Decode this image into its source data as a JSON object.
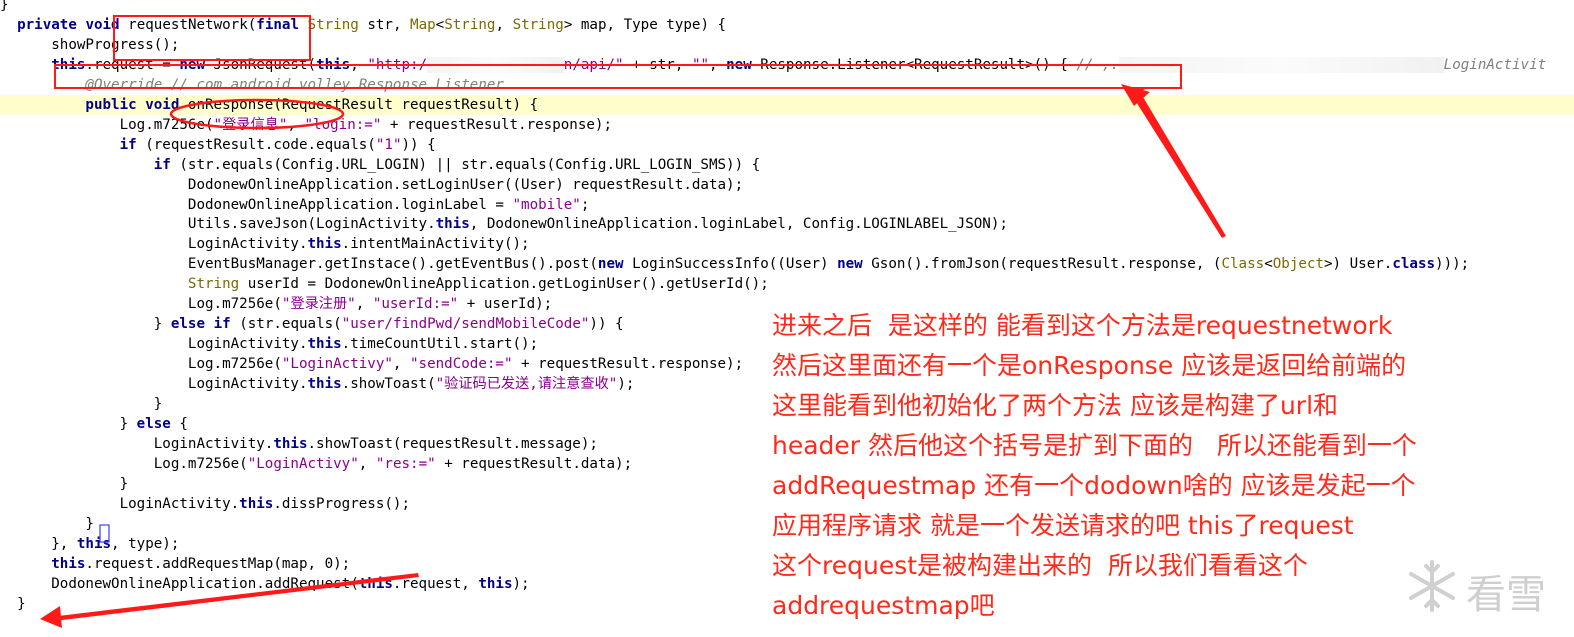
{
  "code_lines": [
    {
      "id": "l0",
      "segments": [
        {
          "t": "}",
          "c": ""
        }
      ]
    },
    {
      "id": "l1",
      "segments": [
        {
          "t": "  ",
          "c": ""
        },
        {
          "t": "private",
          "c": "kw"
        },
        {
          "t": " ",
          "c": ""
        },
        {
          "t": "void",
          "c": "kw"
        },
        {
          "t": " requestNetwork(",
          "c": ""
        },
        {
          "t": "final",
          "c": "kw"
        },
        {
          "t": " ",
          "c": ""
        },
        {
          "t": "String",
          "c": "typ"
        },
        {
          "t": " str, ",
          "c": ""
        },
        {
          "t": "Map",
          "c": "typ"
        },
        {
          "t": "<",
          "c": ""
        },
        {
          "t": "String",
          "c": "typ"
        },
        {
          "t": ", ",
          "c": ""
        },
        {
          "t": "String",
          "c": "typ"
        },
        {
          "t": "> map, Type type) {",
          "c": ""
        }
      ]
    },
    {
      "id": "l2",
      "segments": [
        {
          "t": "      showProgress();",
          "c": ""
        }
      ]
    },
    {
      "id": "l3",
      "segments": [
        {
          "t": "      ",
          "c": ""
        },
        {
          "t": "this",
          "c": "kw"
        },
        {
          "t": ".request = ",
          "c": ""
        },
        {
          "t": "new",
          "c": "kw"
        },
        {
          "t": " JsonRequest(",
          "c": ""
        },
        {
          "t": "this",
          "c": "kw"
        },
        {
          "t": ", ",
          "c": ""
        },
        {
          "t": "\"http:/",
          "c": "str"
        },
        {
          "t": "xxxxxxxxxxxxxxxx",
          "c": "blank"
        },
        {
          "t": "n/api/\"",
          "c": "str"
        },
        {
          "t": " + str, ",
          "c": ""
        },
        {
          "t": "\"\"",
          "c": "str"
        },
        {
          "t": ", ",
          "c": ""
        },
        {
          "t": "new",
          "c": "kw"
        },
        {
          "t": " Response.Listener<RequestResult>() { ",
          "c": ""
        },
        {
          "t": "// ,.",
          "c": "com"
        },
        {
          "t": "xxxxxxxxxxxxxxxxxxxxxxxxxxxxxxxxxxxxxx",
          "c": "blank"
        },
        {
          "t": "LoginActivit",
          "c": "com"
        }
      ]
    },
    {
      "id": "l4",
      "segments": [
        {
          "t": "          ",
          "c": ""
        },
        {
          "t": "@Override // com.android.volley.Response.Listener",
          "c": "com"
        }
      ]
    },
    {
      "id": "l5",
      "hl": true,
      "segments": [
        {
          "t": "          ",
          "c": ""
        },
        {
          "t": "public",
          "c": "kw"
        },
        {
          "t": " ",
          "c": ""
        },
        {
          "t": "void",
          "c": "kw"
        },
        {
          "t": " onResponse(RequestResult requestResult) {",
          "c": ""
        }
      ]
    },
    {
      "id": "l6",
      "segments": [
        {
          "t": "              Log.m7256e(",
          "c": ""
        },
        {
          "t": "\"登录信息\"",
          "c": "str"
        },
        {
          "t": ", ",
          "c": ""
        },
        {
          "t": "\"login:=\"",
          "c": "str"
        },
        {
          "t": " + requestResult.response);",
          "c": ""
        }
      ]
    },
    {
      "id": "l7",
      "segments": [
        {
          "t": "              ",
          "c": ""
        },
        {
          "t": "if",
          "c": "kw"
        },
        {
          "t": " (requestResult.code.equals(",
          "c": ""
        },
        {
          "t": "\"1\"",
          "c": "str"
        },
        {
          "t": ")) {",
          "c": ""
        }
      ]
    },
    {
      "id": "l8",
      "segments": [
        {
          "t": "                  ",
          "c": ""
        },
        {
          "t": "if",
          "c": "kw"
        },
        {
          "t": " (str.equals(Config.URL_LOGIN) || str.equals(Config.URL_LOGIN_SMS)) {",
          "c": ""
        }
      ]
    },
    {
      "id": "l9",
      "segments": [
        {
          "t": "                      DodonewOnlineApplication.setLoginUser((User) requestResult.data);",
          "c": ""
        }
      ]
    },
    {
      "id": "l10",
      "segments": [
        {
          "t": "                      DodonewOnlineApplication.loginLabel = ",
          "c": ""
        },
        {
          "t": "\"mobile\"",
          "c": "str"
        },
        {
          "t": ";",
          "c": ""
        }
      ]
    },
    {
      "id": "l11",
      "segments": [
        {
          "t": "                      Utils.saveJson(LoginActivity.",
          "c": ""
        },
        {
          "t": "this",
          "c": "kw"
        },
        {
          "t": ", DodonewOnlineApplication.loginLabel, Config.LOGINLABEL_JSON);",
          "c": ""
        }
      ]
    },
    {
      "id": "l12",
      "segments": [
        {
          "t": "                      LoginActivity.",
          "c": ""
        },
        {
          "t": "this",
          "c": "kw"
        },
        {
          "t": ".intentMainActivity();",
          "c": ""
        }
      ]
    },
    {
      "id": "l13",
      "segments": [
        {
          "t": "                      EventBusManager.getInstace().getEventBus().post(",
          "c": ""
        },
        {
          "t": "new",
          "c": "kw"
        },
        {
          "t": " LoginSuccessInfo((User) ",
          "c": ""
        },
        {
          "t": "new",
          "c": "kw"
        },
        {
          "t": " Gson().fromJson(requestResult.response, (",
          "c": ""
        },
        {
          "t": "Class",
          "c": "typ"
        },
        {
          "t": "<",
          "c": ""
        },
        {
          "t": "Object",
          "c": "typ"
        },
        {
          "t": ">) User.",
          "c": ""
        },
        {
          "t": "class",
          "c": "kw"
        },
        {
          "t": ")));",
          "c": ""
        }
      ]
    },
    {
      "id": "l14",
      "segments": [
        {
          "t": "                      ",
          "c": ""
        },
        {
          "t": "String",
          "c": "typ"
        },
        {
          "t": " userId = DodonewOnlineApplication.getLoginUser().getUserId();",
          "c": ""
        }
      ]
    },
    {
      "id": "l15",
      "segments": [
        {
          "t": "                      Log.m7256e(",
          "c": ""
        },
        {
          "t": "\"登录注册\"",
          "c": "str"
        },
        {
          "t": ", ",
          "c": ""
        },
        {
          "t": "\"userId:=\"",
          "c": "str"
        },
        {
          "t": " + userId);",
          "c": ""
        }
      ]
    },
    {
      "id": "l16",
      "segments": [
        {
          "t": "                  } ",
          "c": ""
        },
        {
          "t": "else",
          "c": "kw"
        },
        {
          "t": " ",
          "c": ""
        },
        {
          "t": "if",
          "c": "kw"
        },
        {
          "t": " (str.equals(",
          "c": ""
        },
        {
          "t": "\"user/findPwd/sendMobileCode\"",
          "c": "str"
        },
        {
          "t": ")) {",
          "c": ""
        }
      ]
    },
    {
      "id": "l17",
      "segments": [
        {
          "t": "                      LoginActivity.",
          "c": ""
        },
        {
          "t": "this",
          "c": "kw"
        },
        {
          "t": ".timeCountUtil.start();",
          "c": ""
        }
      ]
    },
    {
      "id": "l18",
      "segments": [
        {
          "t": "                      Log.m7256e(",
          "c": ""
        },
        {
          "t": "\"LoginActivy\"",
          "c": "str"
        },
        {
          "t": ", ",
          "c": ""
        },
        {
          "t": "\"sendCode:=\"",
          "c": "str"
        },
        {
          "t": " + requestResult.response);",
          "c": ""
        }
      ]
    },
    {
      "id": "l19",
      "segments": [
        {
          "t": "                      LoginActivity.",
          "c": ""
        },
        {
          "t": "this",
          "c": "kw"
        },
        {
          "t": ".showToast(",
          "c": ""
        },
        {
          "t": "\"验证码已发送,请注意查收\"",
          "c": "str"
        },
        {
          "t": ");",
          "c": ""
        }
      ]
    },
    {
      "id": "l20",
      "segments": [
        {
          "t": "                  }",
          "c": ""
        }
      ]
    },
    {
      "id": "l21",
      "segments": [
        {
          "t": "              } ",
          "c": ""
        },
        {
          "t": "else",
          "c": "kw"
        },
        {
          "t": " {",
          "c": ""
        }
      ]
    },
    {
      "id": "l22",
      "segments": [
        {
          "t": "                  LoginActivity.",
          "c": ""
        },
        {
          "t": "this",
          "c": "kw"
        },
        {
          "t": ".showToast(requestResult.message);",
          "c": ""
        }
      ]
    },
    {
      "id": "l23",
      "segments": [
        {
          "t": "                  Log.m7256e(",
          "c": ""
        },
        {
          "t": "\"LoginActivy\"",
          "c": "str"
        },
        {
          "t": ", ",
          "c": ""
        },
        {
          "t": "\"res:=\"",
          "c": "str"
        },
        {
          "t": " + requestResult.data);",
          "c": ""
        }
      ]
    },
    {
      "id": "l24",
      "segments": [
        {
          "t": "              }",
          "c": ""
        }
      ]
    },
    {
      "id": "l25",
      "segments": [
        {
          "t": "              LoginActivity.",
          "c": ""
        },
        {
          "t": "this",
          "c": "kw"
        },
        {
          "t": ".dissProgress();",
          "c": ""
        }
      ]
    },
    {
      "id": "l26",
      "segments": [
        {
          "t": "          }",
          "c": ""
        }
      ]
    },
    {
      "id": "l27",
      "segments": [
        {
          "t": "      }, ",
          "c": ""
        },
        {
          "t": "this",
          "c": "kw"
        },
        {
          "t": ", type);",
          "c": ""
        }
      ]
    },
    {
      "id": "l28",
      "segments": [
        {
          "t": "      ",
          "c": ""
        },
        {
          "t": "this",
          "c": "kw"
        },
        {
          "t": ".request.addRequestMap(map, 0);",
          "c": ""
        }
      ]
    },
    {
      "id": "l29",
      "segments": [
        {
          "t": "      DodonewOnlineApplication.addRequest(",
          "c": ""
        },
        {
          "t": "this",
          "c": "kw"
        },
        {
          "t": ".request, ",
          "c": ""
        },
        {
          "t": "this",
          "c": "kw"
        },
        {
          "t": ");",
          "c": ""
        }
      ]
    },
    {
      "id": "l30",
      "segments": [
        {
          "t": "  }",
          "c": ""
        }
      ]
    }
  ],
  "annotation": {
    "lines": [
      "进来之后  是这样的 能看到这个方法是requestnetwork",
      "然后这里面还有一个是onResponse 应该是返回给前端的",
      "这里能看到他初始化了两个方法 应该是构建了url和",
      "header 然后他这个括号是扩到下面的   所以还能看到一个",
      "addRequestmap 还有一个dodown啥的 应该是发起一个",
      "应用程序请求 就是一个发送请求的吧 this了request",
      "这个request是被构建出来的  所以我们看看这个",
      "addrequestmap吧"
    ]
  },
  "watermark": {
    "text": "看雪",
    "icon": "snowflake-icon"
  },
  "colors": {
    "markup": "#ff1a1a",
    "highlight": "#ffffcc",
    "keyword": "#00008b",
    "string": "#8b008b"
  }
}
